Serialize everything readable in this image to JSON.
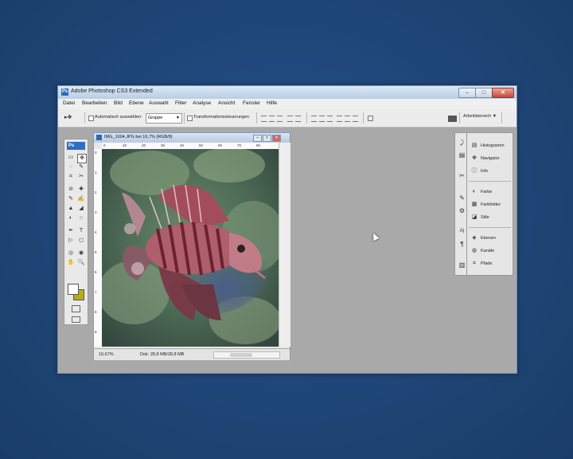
{
  "window": {
    "title": "Adobe Photoshop CS3 Extended",
    "app_icon": "Ps",
    "controls": {
      "minimize": "–",
      "maximize": "□",
      "close": "✕"
    }
  },
  "menu": [
    "Datei",
    "Bearbeiten",
    "Bild",
    "Ebene",
    "Auswahl",
    "Filter",
    "Analyse",
    "Ansicht",
    "Fenster",
    "Hilfe"
  ],
  "options": {
    "tool_arrow": "▸✥",
    "auto_select_label": "Automatisch auswählen:",
    "group_value": "Gruppe",
    "transform_label": "Transformationssteuerungen",
    "workspace_label": "Arbeitsbereich ▼"
  },
  "toolbox": {
    "logo": "Ps",
    "tools": [
      "▭",
      "✥",
      "◌",
      "✎",
      "⌗",
      "✂",
      "⊘",
      "✚",
      "✎",
      "✍",
      "▲",
      "◢",
      "◐",
      "○",
      "◎",
      "◉",
      "✒",
      "T",
      "▷",
      "◻",
      "✋",
      "🔍"
    ],
    "fg_color": "#ffffff",
    "bg_color": "#b6ad1a"
  },
  "document": {
    "title": "IMG_1004.JPG bei 16,7% (RGB/8)",
    "zoom": "16,67%",
    "info": "Dok: 28,8 MB/28,8 MB",
    "ruler_top": [
      "0",
      "10",
      "20",
      "30",
      "40",
      "50",
      "60",
      "70",
      "80"
    ],
    "ruler_left": [
      "0",
      "1",
      "2",
      "3",
      "4",
      "5",
      "6",
      "7",
      "8",
      "9"
    ]
  },
  "panels": {
    "groups": [
      [
        {
          "icon": "▤",
          "label": "Histogramm"
        },
        {
          "icon": "✥",
          "label": "Navigator"
        },
        {
          "icon": "ⓘ",
          "label": "Info"
        }
      ],
      [
        {
          "icon": "◐",
          "label": "Farbe"
        },
        {
          "icon": "▦",
          "label": "Farbfelder"
        },
        {
          "icon": "◪",
          "label": "Stile"
        }
      ],
      [
        {
          "icon": "◈",
          "label": "Ebenen"
        },
        {
          "icon": "◍",
          "label": "Kanäle"
        },
        {
          "icon": "⌗",
          "label": "Pfade"
        }
      ]
    ],
    "dock_icons": [
      "⤸",
      "▤",
      "✂",
      "✎",
      "⚙",
      "A|",
      "¶",
      "▥"
    ]
  }
}
